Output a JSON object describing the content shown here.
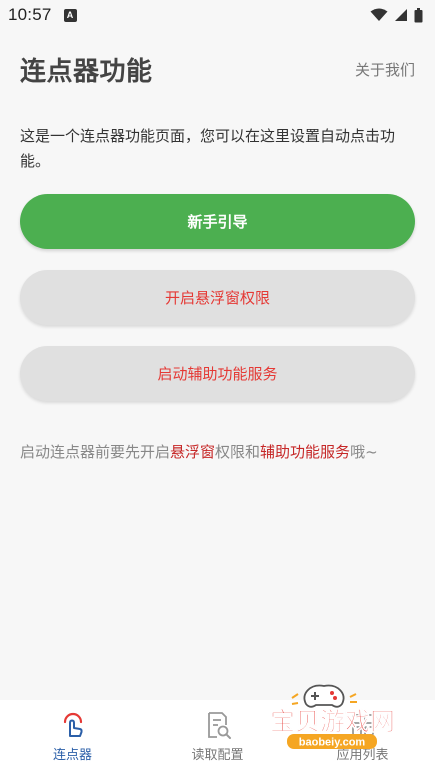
{
  "status_bar": {
    "time": "10:57",
    "notification_icon": "A",
    "icons": [
      "wifi-icon",
      "signal-icon",
      "battery-icon"
    ]
  },
  "header": {
    "title": "连点器功能",
    "about_label": "关于我们"
  },
  "main": {
    "description": "这是一个连点器功能页面，您可以在这里设置自动点击功能。",
    "buttons": {
      "guide": "新手引导",
      "float_permission": "开启悬浮窗权限",
      "accessibility_service": "启动辅助功能服务"
    },
    "hint": {
      "part1": "启动连点器前要先开启",
      "highlight1": "悬浮窗",
      "part2": "权限和",
      "highlight2": "辅助功能服务",
      "part3": "哦~"
    }
  },
  "bottom_nav": {
    "items": [
      {
        "label": "连点器",
        "icon": "tap-hand-icon",
        "active": true
      },
      {
        "label": "读取配置",
        "icon": "document-search-icon",
        "active": false
      },
      {
        "label": "应用列表",
        "icon": "app-list-icon",
        "active": false
      }
    ]
  },
  "watermark": {
    "text": "宝贝游戏网",
    "url": "baobeiy.com"
  },
  "colors": {
    "primary_green": "#4caf50",
    "secondary_gray": "#e0e0e0",
    "danger_red": "#e53935",
    "active_blue": "#2b5fa8"
  }
}
